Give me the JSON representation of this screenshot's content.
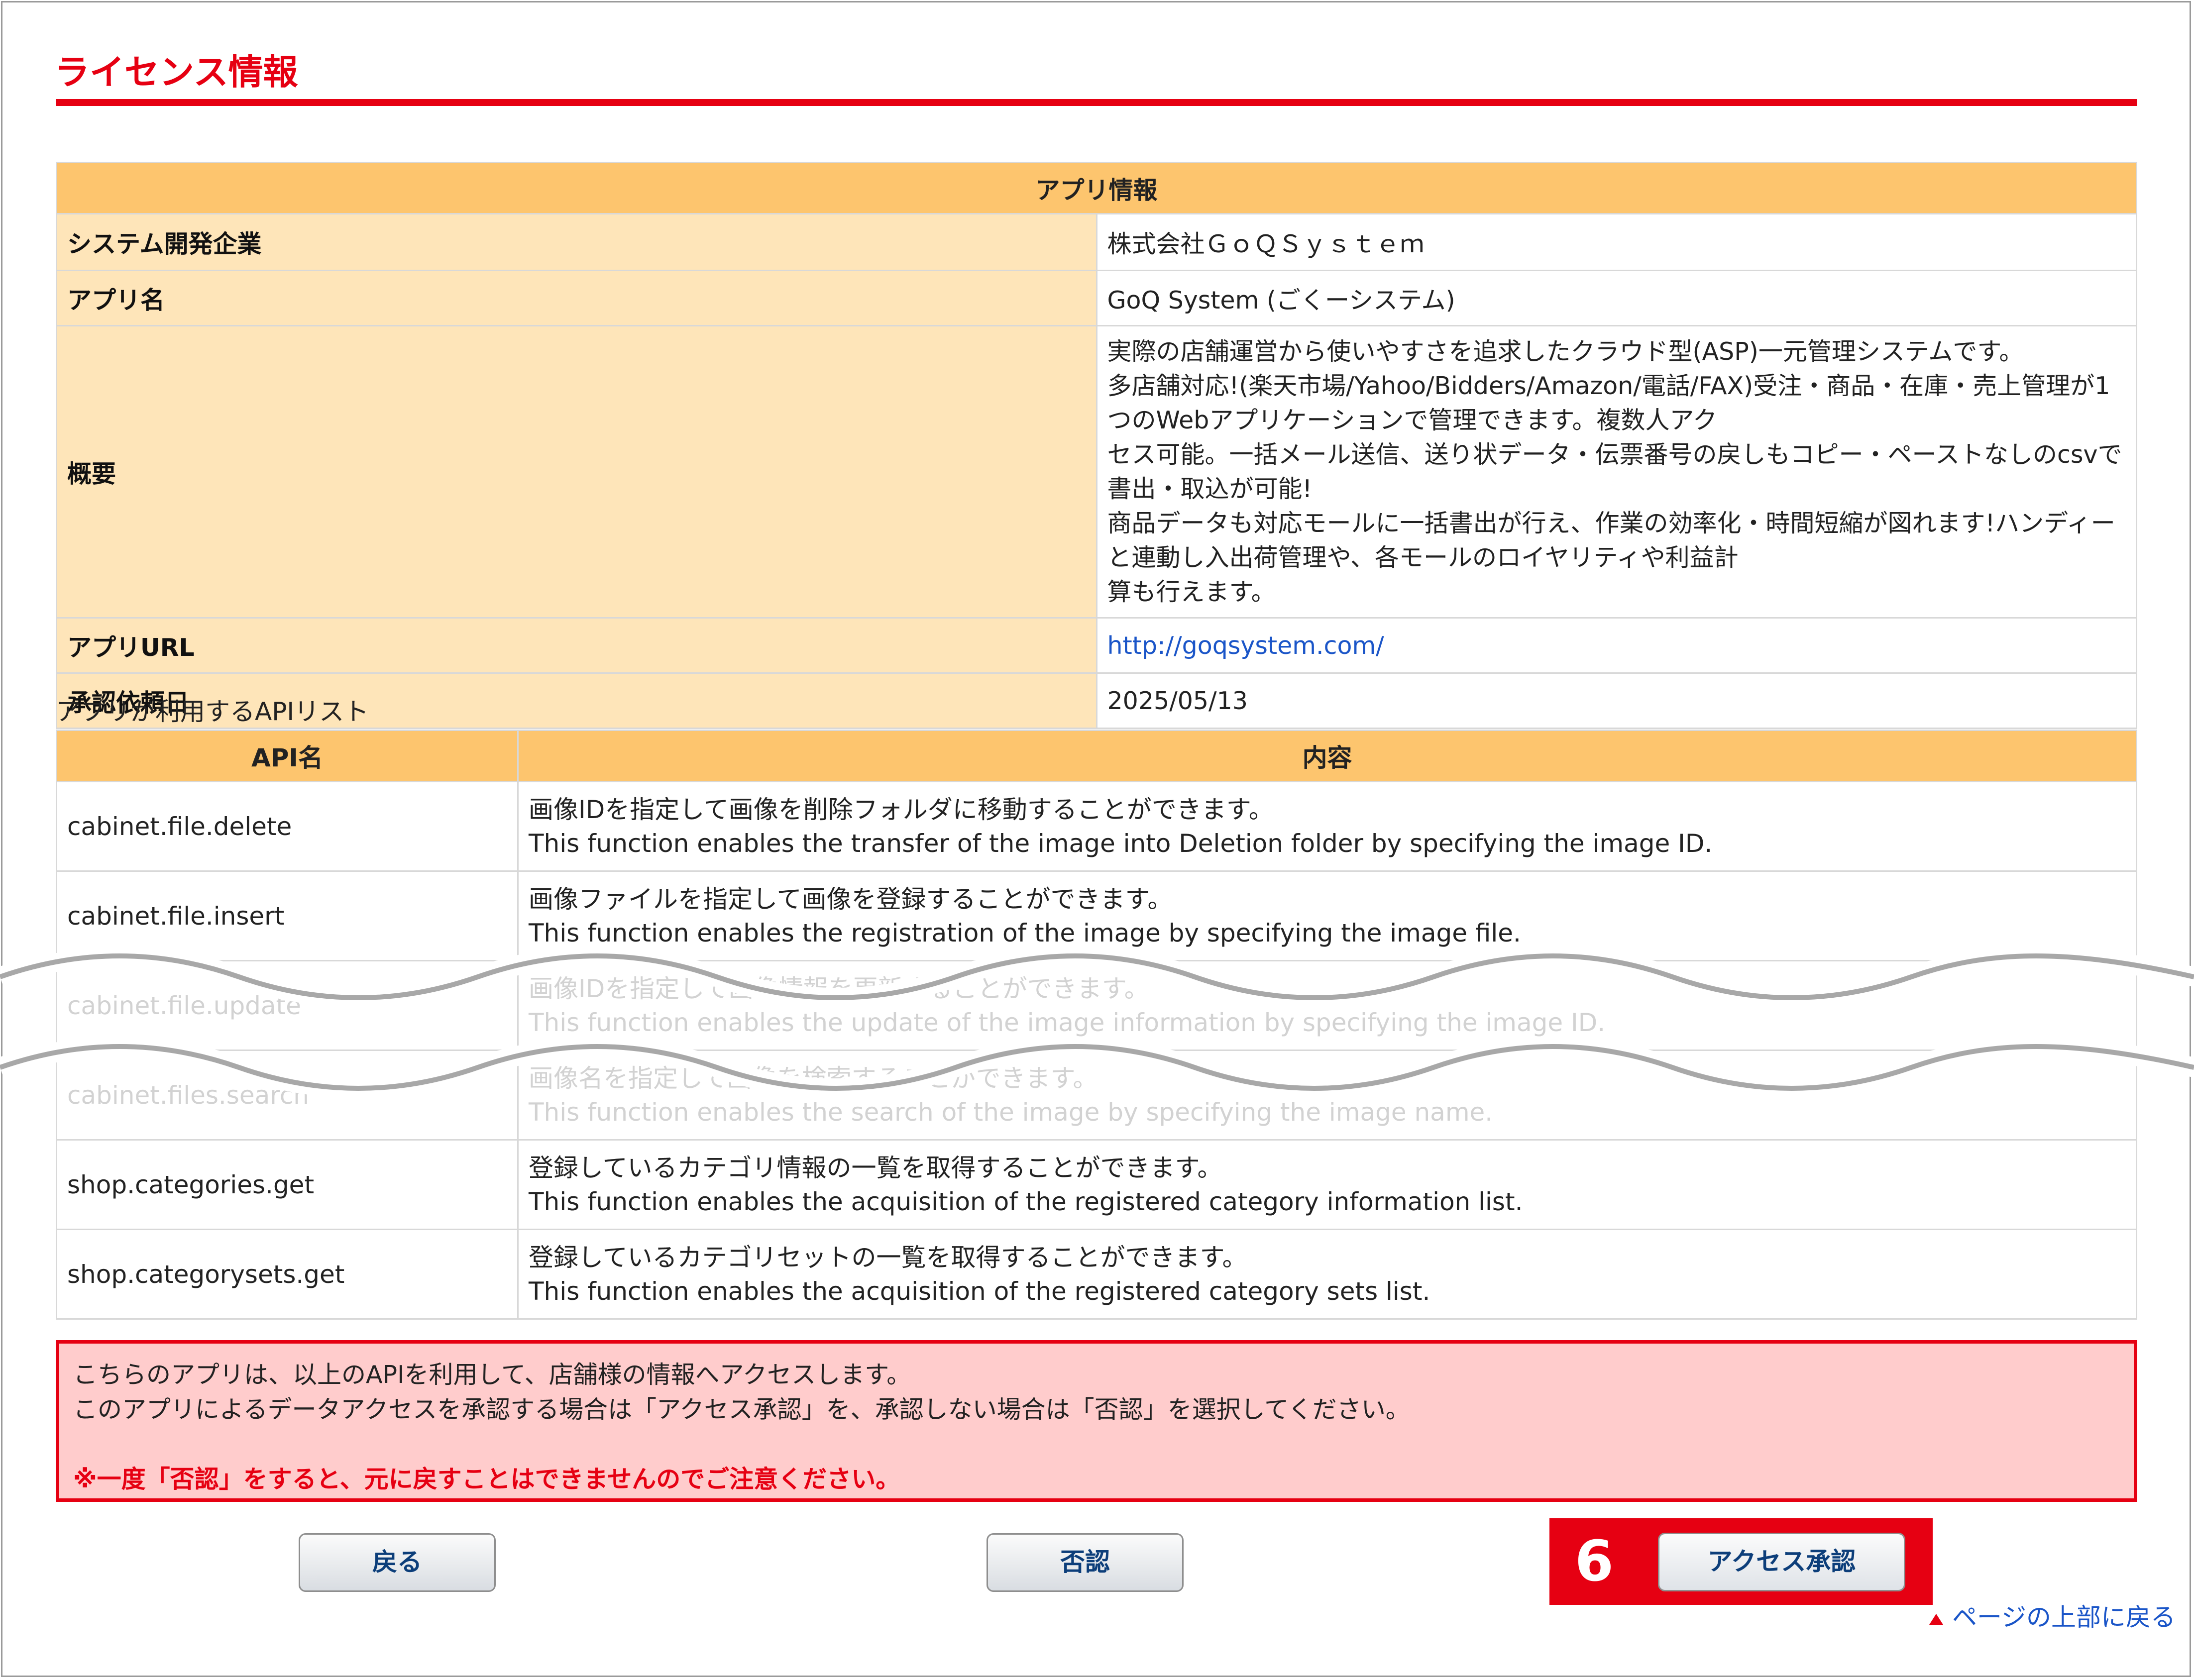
{
  "page": {
    "title": "ライセンス情報"
  },
  "app_info": {
    "header": "アプリ情報",
    "rows": [
      {
        "label": "システム開発企業",
        "value": "株式会社ＧｏＱＳｙｓｔｅｍ"
      },
      {
        "label": "アプリ名",
        "value": "GoQ System (ごくーシステム)"
      },
      {
        "label": "概要",
        "lines": [
          "実際の店舗運営から使いやすさを追求したクラウド型(ASP)一元管理システムです。",
          "多店舗対応!(楽天市場/Yahoo/Bidders/Amazon/電話/FAX)受注・商品・在庫・売上管理が1つのWebアプリケーションで管理できます。複数人アク",
          "セス可能。一括メール送信、送り状データ・伝票番号の戻しもコピー・ペーストなしのcsvで書出・取込が可能!",
          "商品データも対応モールに一括書出が行え、作業の効率化・時間短縮が図れます!ハンディーと連動し入出荷管理や、各モールのロイヤリティや利益計",
          "算も行えます。"
        ]
      },
      {
        "label": "アプリURL",
        "value": "http://goqsystem.com/"
      },
      {
        "label": "承認依頼日",
        "value": "2025/05/13"
      }
    ]
  },
  "api_list": {
    "caption": "アプリが利用するAPIリスト",
    "col_name": "API名",
    "col_desc": "内容",
    "rows": [
      {
        "name": "cabinet.file.delete",
        "jp": "画像IDを指定して画像を削除フォルダに移動することができます。",
        "en": "This function enables the transfer of the image into Deletion folder by specifying the image ID."
      },
      {
        "name": "cabinet.file.insert",
        "jp": "画像ファイルを指定して画像を登録することができます。",
        "en": "This function enables the registration of the image by specifying the image file."
      },
      {
        "name": "cabinet.file.update",
        "jp": "画像IDを指定して画像情報を更新することができます。",
        "en": "This function enables the update of the image information by specifying the image ID."
      },
      {
        "name": "cabinet.files.search",
        "jp": "画像名を指定して画像を検索することができます。",
        "en": "This function enables the search of the image by specifying the image name."
      },
      {
        "name": "shop.categories.get",
        "jp": "登録しているカテゴリ情報の一覧を取得することができます。",
        "en": "This function enables the acquisition of the registered category information list."
      },
      {
        "name": "shop.categorysets.get",
        "jp": "登録しているカテゴリセットの一覧を取得することができます。",
        "en": "This function enables the acquisition of the registered category sets list."
      }
    ]
  },
  "notice": {
    "line1": "こちらのアプリは、以上のAPIを利用して、店舗様の情報へアクセスします。",
    "line2": "このアプリによるデータアクセスを承認する場合は「アクセス承認」を、承認しない場合は「否認」を選択してください。",
    "warning": "※一度「否認」をすると、元に戻すことはできませんのでご注意ください。"
  },
  "buttons": {
    "back": "戻る",
    "deny": "否認",
    "approve": "アクセス承認"
  },
  "step_number": "6",
  "page_top_link": "ページの上部に戻る",
  "colors": {
    "accent_red": "#e60012",
    "table_header": "#fdc56e",
    "row_label_bg": "#fee5b9",
    "link_blue": "#1a55c8",
    "notice_bg": "#ffcccc"
  }
}
